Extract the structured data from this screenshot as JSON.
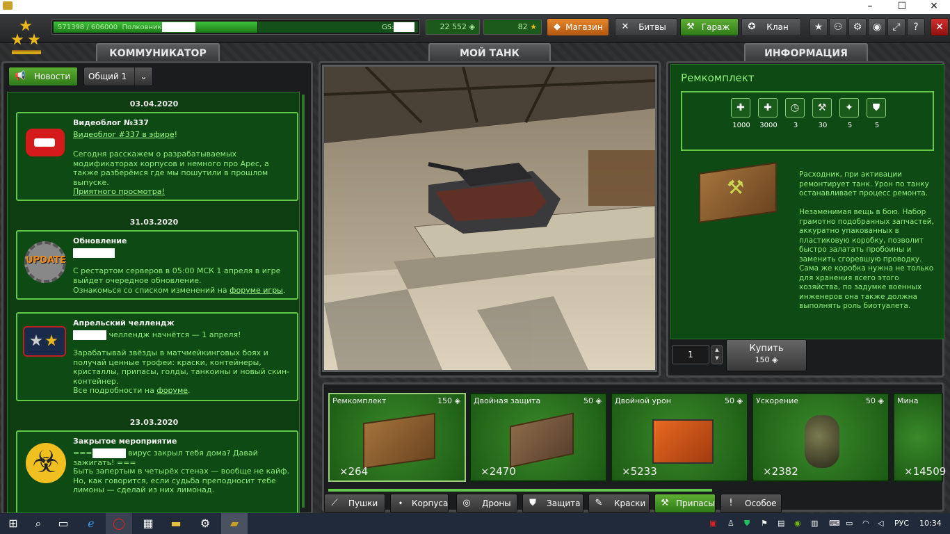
{
  "window": {
    "minimize": "–",
    "maximize": "☐",
    "close": "✕"
  },
  "topbar": {
    "xp_text": "571398 / 606000",
    "rank_name": "Полковник",
    "xp_progress": 0.943,
    "gs_label": "GS:",
    "crystals": "22 552",
    "stars": "82",
    "shop_label": "Магазин",
    "battles_label": "Битвы",
    "garage_label": "Гараж",
    "clan_label": "Клан"
  },
  "panels": {
    "communicator": "КОММУНИКАТОР",
    "my_tank": "МОЙ ТАНК",
    "information": "ИНФОРМАЦИЯ"
  },
  "communicator": {
    "news_button": "Новости",
    "channel_select": "Общий 1",
    "items": [
      {
        "date": "03.04.2020",
        "title": "Видеоблог №337",
        "link": "Видеоблог #337 в эфире",
        "link_suffix": "!",
        "body": "Сегодня расскажем о разрабатываемых модификаторах корпусов и немного про Арес, а также разберёмся где мы пошутили в прошлом выпуске.",
        "footer_link": "Приятного просмотра!"
      },
      {
        "date": "31.03.2020",
        "title": "Обновление",
        "icon_text": "UPDATE",
        "body": "С рестартом серверов в 05:00 МСК 1 апреля в игре выйдет очередное обновление.",
        "footer_prefix": "Ознакомься со списком изменений на ",
        "footer_link": "форуме игры",
        "footer_suffix": "."
      },
      {
        "date": "",
        "title": "Апрельский челлендж",
        "line1": "челлендж начнётся — 1 апреля!",
        "body": "Зарабатывай звёзды в матчмейкинговых боях и получай ценные трофеи: краски, контейнеры, кристаллы, припасы, голды, танкоины и новый скин-контейнер.",
        "footer_prefix": "Все подробности на ",
        "footer_link": "форуме",
        "footer_suffix": "."
      },
      {
        "date": "23.03.2020",
        "title": "Закрытое мероприятие",
        "line1_prefix": "===",
        "line1": "вирус закрыл тебя дома? Давай зажигать! ===",
        "body": "Быть запертым в четырёх стенах — вообще не кайф. Но, как говорится, если судьба преподносит тебе лимоны — сделай из них лимонад."
      }
    ]
  },
  "info": {
    "title": "Ремкомплект",
    "props": [
      "1000",
      "3000",
      "3",
      "30",
      "5",
      "5"
    ],
    "desc1": "Расходник, при активации ремонтирует танк. Урон по танку останавливает процесс ремонта.",
    "desc2": "Незаменимая вещь в бою. Набор грамотно подобранных запчастей, аккуратно упакованных в пластиковую коробку, позволит быстро залатать пробоины и заменить сгоревшую проводку. Сама же коробка нужна не только для хранения всего этого хозяйства, по задумке военных инженеров она также должна выполнять роль биотуалета.",
    "quantity": "1",
    "buy_label": "Купить",
    "buy_price": "150"
  },
  "supplies": [
    {
      "name": "Ремкомплект",
      "price": "150",
      "count": "×264"
    },
    {
      "name": "Двойная защита",
      "price": "50",
      "count": "×2470"
    },
    {
      "name": "Двойной урон",
      "price": "50",
      "count": "×5233"
    },
    {
      "name": "Ускорение",
      "price": "50",
      "count": "×2382"
    },
    {
      "name": "Мина",
      "price": "",
      "count": "×14509"
    }
  ],
  "garage_tabs": [
    "Пушки",
    "Корпуса",
    "Дроны",
    "Защита",
    "Краски",
    "Припасы",
    "Особое"
  ],
  "taskbar": {
    "lang": "РУС",
    "time": "10:34"
  },
  "colors": {
    "accent": "#62c84a",
    "panel_green": "#0e4a13",
    "news_text": "#8ef07a"
  }
}
